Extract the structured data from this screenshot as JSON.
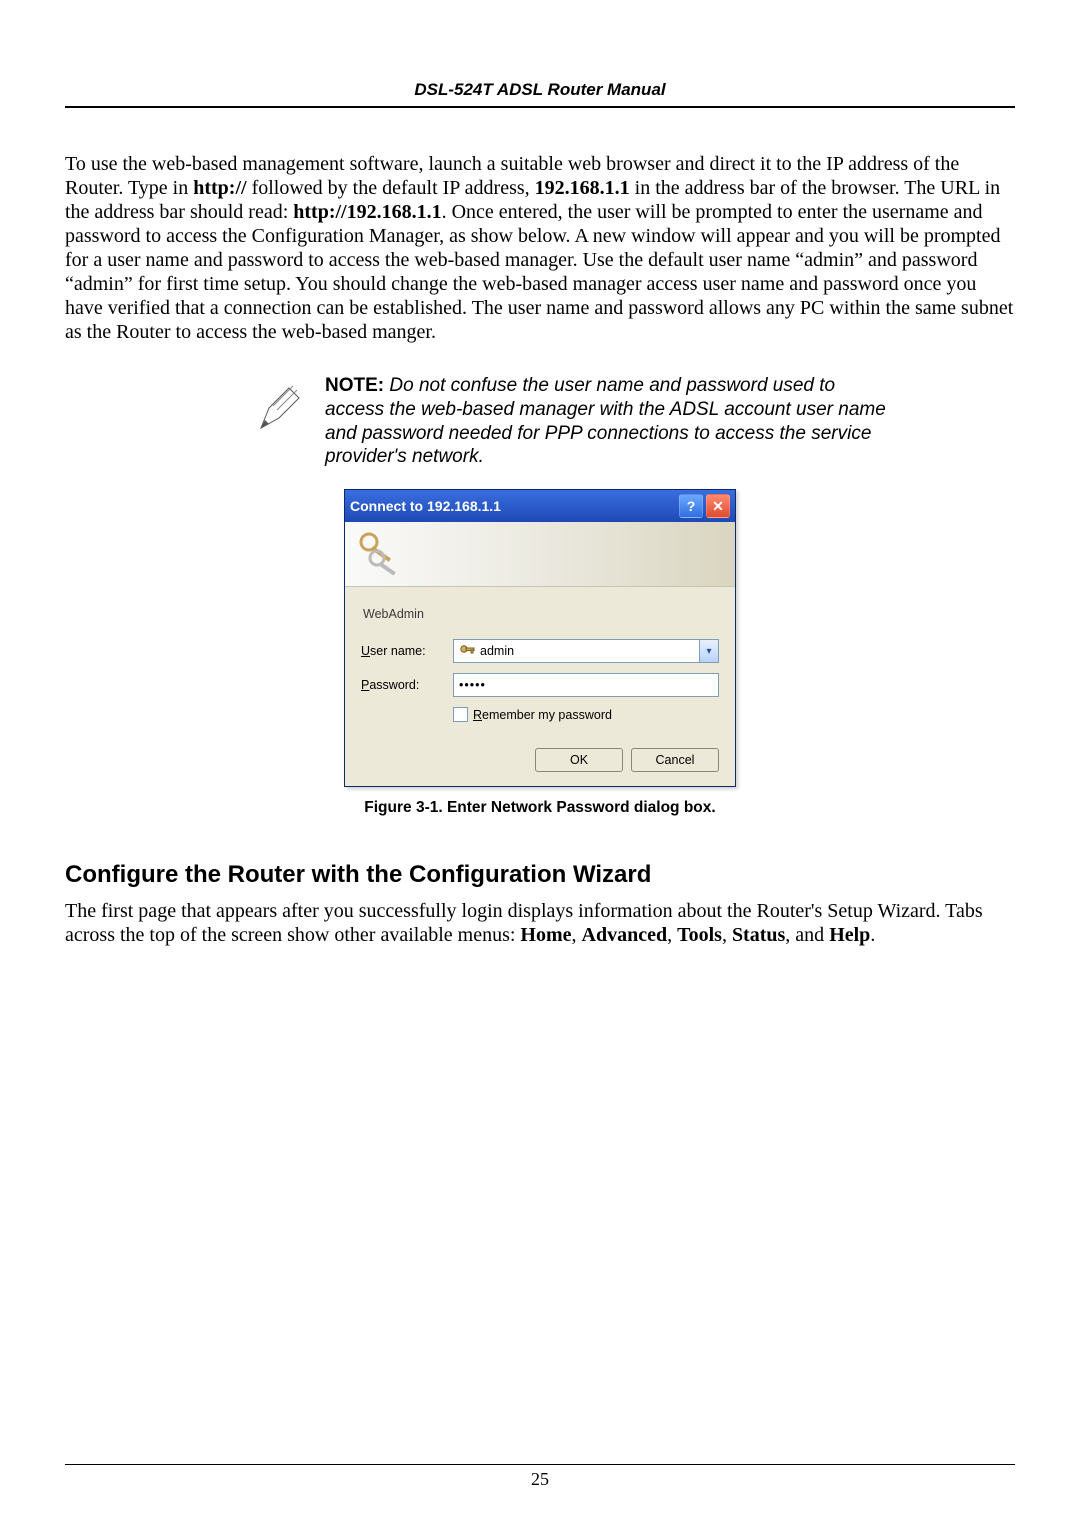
{
  "header": {
    "title": "DSL-524T ADSL Router Manual"
  },
  "paragraph1": {
    "p1a": "To use the web-based management software, launch a suitable web browser and direct it to the IP address of the Router. Type in ",
    "b1": "http://",
    "p1b": " followed by the default IP address, ",
    "b2": "192.168.1.1",
    "p1c": " in the address bar of the browser. The URL in the address bar should read: ",
    "b3": "http://192.168.1.1",
    "p1d": ". Once entered, the user will be prompted to enter the username and password to access the Configuration Manager, as show below. A new window will appear and you will be prompted for a user name and password to access the web-based manager. Use the default user name “admin” and password “admin” for first time setup. You should change the web-based manager access user name and password once you have verified that a connection can be established. The user name and password allows any PC within the same subnet as the Router to access the web-based manger."
  },
  "note": {
    "label": "NOTE:",
    "text": " Do not confuse the user name and password used to access the web-based manager with the ADSL account user name and password needed for PPP connections to access the service provider's network."
  },
  "dialog": {
    "title": "Connect to 192.168.1.1",
    "realm": "WebAdmin",
    "username_label_pre": "U",
    "username_label_rest": "ser name:",
    "password_label_pre": "P",
    "password_label_rest": "assword:",
    "username_value": "admin",
    "password_value": "•••••",
    "remember_pre": "R",
    "remember_rest": "emember my password",
    "ok": "OK",
    "cancel": "Cancel"
  },
  "figure_caption": "Figure 3-1. Enter Network Password dialog box.",
  "section_heading": "Configure the Router with the Configuration Wizard",
  "paragraph2": {
    "a": "The first page that appears after you successfully login displays information about the Router's Setup Wizard. Tabs across the top of the screen show other available menus: ",
    "b1": "Home",
    "s1": ", ",
    "b2": "Advanced",
    "s2": ", ",
    "b3": "Tools",
    "s3": ", ",
    "b4": "Status",
    "s4": ", and ",
    "b5": "Help",
    "s5": "."
  },
  "page_number": "25"
}
